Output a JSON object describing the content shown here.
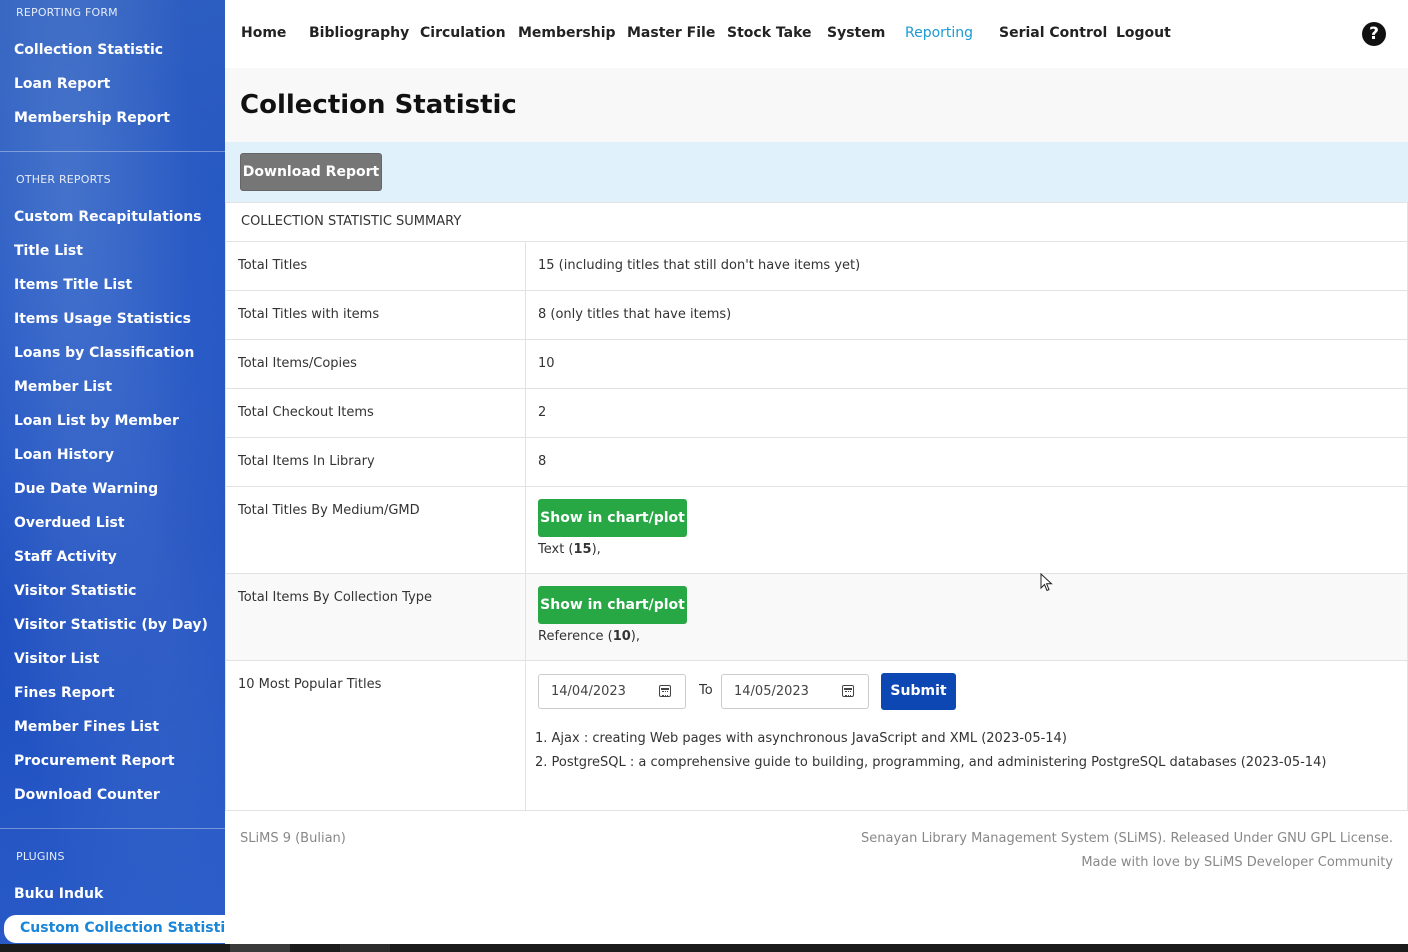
{
  "sidebar": {
    "reporting_heading": "REPORTING FORM",
    "reporting_items": [
      "Collection Statistic",
      "Loan Report",
      "Membership Report"
    ],
    "other_heading": "OTHER REPORTS",
    "other_items": [
      "Custom Recapitulations",
      "Title List",
      "Items Title List",
      "Items Usage Statistics",
      "Loans by Classification",
      "Member List",
      "Loan List by Member",
      "Loan History",
      "Due Date Warning",
      "Overdued List",
      "Staff Activity",
      "Visitor Statistic",
      "Visitor Statistic (by Day)",
      "Visitor List",
      "Fines Report",
      "Member Fines List",
      "Procurement Report",
      "Download Counter"
    ],
    "plugins_heading": "PLUGINS",
    "plugin_items": [
      "Buku Induk"
    ],
    "active_item": "Custom Collection Statistic"
  },
  "nav": {
    "items": [
      "Home",
      "Bibliography",
      "Circulation",
      "Membership",
      "Master File",
      "Stock Take",
      "System",
      "Reporting",
      "Serial Control",
      "Logout"
    ],
    "active": "Reporting",
    "help_icon": "question-circle-icon"
  },
  "page": {
    "title": "Collection Statistic",
    "download_label": "Download Report"
  },
  "summary": {
    "heading": "COLLECTION STATISTIC SUMMARY",
    "rows": [
      {
        "label": "Total Titles",
        "value": "15 (including titles that still don't have items yet)"
      },
      {
        "label": "Total Titles with items",
        "value": "8 (only titles that have items)"
      },
      {
        "label": "Total Items/Copies",
        "value": "10"
      },
      {
        "label": "Total Checkout Items",
        "value": "2"
      },
      {
        "label": "Total Items In Library",
        "value": "8"
      }
    ],
    "gmd": {
      "label": "Total Titles By Medium/GMD",
      "button": "Show in chart/plot",
      "entry_name": "Text",
      "entry_count": "15"
    },
    "coll_type": {
      "label": "Total Items By Collection Type",
      "button": "Show in chart/plot",
      "entry_name": "Reference",
      "entry_count": "10"
    },
    "popular": {
      "label": "10 Most Popular Titles",
      "date_from": "14/04/2023",
      "to_label": "To",
      "date_to": "14/05/2023",
      "submit_label": "Submit",
      "titles": [
        "1. Ajax : creating Web pages with asynchronous JavaScript and XML (2023-05-14)",
        "2. PostgreSQL : a comprehensive guide to building, programming, and administering PostgreSQL databases (2023-05-14)"
      ]
    }
  },
  "footer": {
    "version": "SLiMS 9 (Bulian)",
    "license": "Senayan Library Management System (SLiMS). Released Under GNU GPL License.",
    "credit": "Made with love by SLiMS Developer Community"
  },
  "colors": {
    "sidebar": "#2456c4",
    "nav_active": "#1a9ad6",
    "chart_button": "#28a745",
    "submit_button": "#0d47b3",
    "download_button": "#767676",
    "action_bar": "#e1f1fb"
  }
}
